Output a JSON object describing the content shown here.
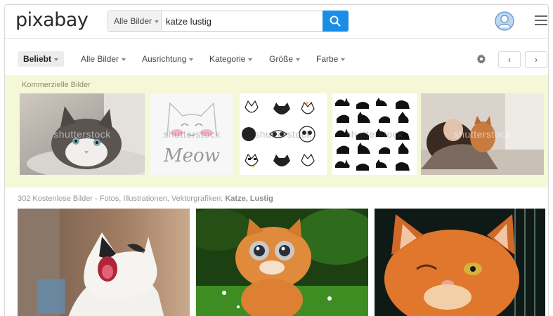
{
  "header": {
    "logo": "pixabay",
    "search": {
      "type_label": "Alle Bilder",
      "query": "katze lustig"
    }
  },
  "filters": {
    "sort": "Beliebt",
    "items": [
      "Alle Bilder",
      "Ausrichtung",
      "Kategorie",
      "Größe",
      "Farbe"
    ],
    "prev": "‹",
    "next": "›"
  },
  "commercial": {
    "title": "Kommerzielle Bilder",
    "watermark": "shutterstock",
    "thumb_text_meow": "Meow"
  },
  "results": {
    "label": "302 Kostenlose Bilder - Fotos, Illustrationen, Vektorgrafiken:",
    "query_bold": "Katze, Lustig"
  },
  "colors": {
    "accent": "#1a8ee6",
    "commercial_bg": "#f4f8d7"
  }
}
